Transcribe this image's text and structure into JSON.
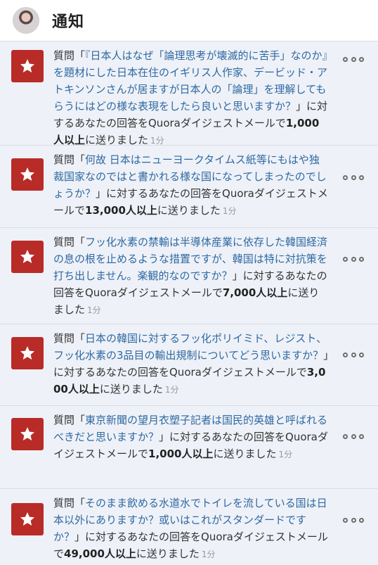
{
  "header": {
    "title": "通知"
  },
  "notifications": [
    {
      "prefix": "質問「",
      "question": "『日本人はなぜ「論理思考が壊滅的に苦手」なのか』を題材にした日本在住のイギリス人作家、デービッド・アトキンソンさんが居ますが日本人の「論理」を理解してもらうにはどの様な表現をしたら良いと思いますか？",
      "middle": "」に対するあなたの回答をQuoraダイジェストメールで",
      "count": "1,000人以上",
      "suffix": "に送りました",
      "time": "1分"
    },
    {
      "prefix": "質問「",
      "question": "何故 日本はニューヨークタイムス紙等にもはや独裁国家なのではと書かれる様な国になってしまったのでしょうか？",
      "middle": "」に対するあなたの回答をQuoraダイジェストメールで",
      "count": "13,000人以上",
      "suffix": "に送りました",
      "time": "1分"
    },
    {
      "prefix": "質問「",
      "question": "フッ化水素の禁輸は半導体産業に依存した韓国経済の息の根を止めるような措置ですが、韓国は特に対抗策を打ち出しません。楽観的なのですか？",
      "middle": "」に対するあなたの回答をQuoraダイジェストメールで",
      "count": "7,000人以上",
      "suffix": "に送りました",
      "time": "1分"
    },
    {
      "prefix": "質問「",
      "question": "日本の韓国に対するフッ化ポリイミド、レジスト、フッ化水素の3品目の輸出規制についてどう思いますか？",
      "middle": "」に対するあなたの回答をQuoraダイジェストメールで",
      "count": "3,000人以上",
      "suffix": "に送りました",
      "time": "1分"
    },
    {
      "prefix": "質問「",
      "question": "東京新聞の望月衣塑子記者は国民的英雄と呼ばれるべきだと思いますか？",
      "middle": "」に対するあなたの回答をQuoraダイジェストメールで",
      "count": "1,000人以上",
      "suffix": "に送りました",
      "time": "1分"
    },
    {
      "prefix": "質問「",
      "question": "そのまま飲める水道水でトイレを流している国は日本以外にありますか？或いはこれがスタンダードですか？",
      "middle": "」に対するあなたの回答をQuoraダイジェストメールで",
      "count": "49,000人以上",
      "suffix": "に送りました",
      "time": "1分"
    }
  ],
  "icons": {
    "badge": "star-icon",
    "menu": "more-options-icon"
  },
  "colors": {
    "badge": "#b92b27",
    "link": "#2e69a3",
    "background": "#eef1f7"
  }
}
